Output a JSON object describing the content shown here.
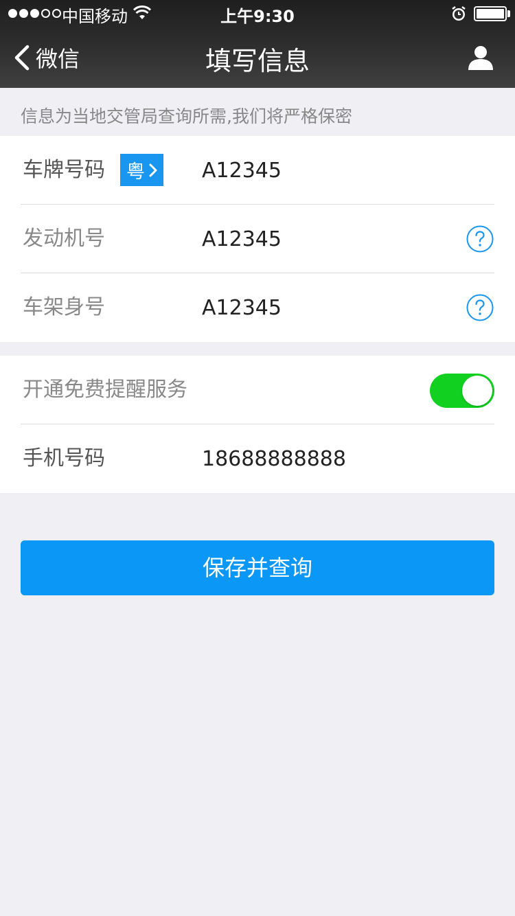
{
  "status_bar": {
    "carrier": "中国移动",
    "time": "上午9:30"
  },
  "nav": {
    "back_label": "微信",
    "title": "填写信息"
  },
  "hint": "信息为当地交管局查询所需,我们将严格保密",
  "vehicle": {
    "plate": {
      "label": "车牌号码",
      "province": "粤",
      "value": "A12345"
    },
    "engine": {
      "label": "发动机号",
      "value": "A12345"
    },
    "vin": {
      "label": "车架身号",
      "value": "A12345"
    }
  },
  "reminder": {
    "label": "开通免费提醒服务",
    "enabled": true,
    "phone_label": "手机号码",
    "phone_value": "18688888888"
  },
  "submit_label": "保存并查询",
  "colors": {
    "accent": "#0a97f5",
    "toggle_on": "#12d020",
    "help_icon": "#1996f0"
  }
}
